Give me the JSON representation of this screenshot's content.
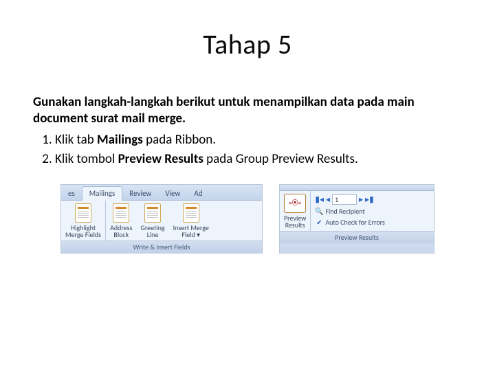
{
  "title": "Tahap 5",
  "intro": "Gunakan langkah-langkah berikut untuk menampilkan data pada main document surat mail merge.",
  "steps": [
    {
      "pre": "Klik tab ",
      "bold": "Mailings",
      "post": " pada Ribbon."
    },
    {
      "pre": "Klik tombol ",
      "bold": "Preview Results",
      "post": " pada Group Preview Results."
    }
  ],
  "ribbon_left": {
    "tabs": {
      "cut": "es",
      "active": "Mailings",
      "t2": "Review",
      "t3": "View",
      "t4_cut": "Ad"
    },
    "btns": {
      "highlight": "Highlight\nMerge Fields",
      "address": "Address\nBlock",
      "greeting": "Greeting\nLine",
      "insert": "Insert Merge\nField ▾"
    },
    "group": "Write & Insert Fields"
  },
  "ribbon_right": {
    "preview": "Preview\nResults",
    "record": "1",
    "find": "Find Recipient",
    "auto": "Auto Check for Errors",
    "group": "Preview Results"
  }
}
